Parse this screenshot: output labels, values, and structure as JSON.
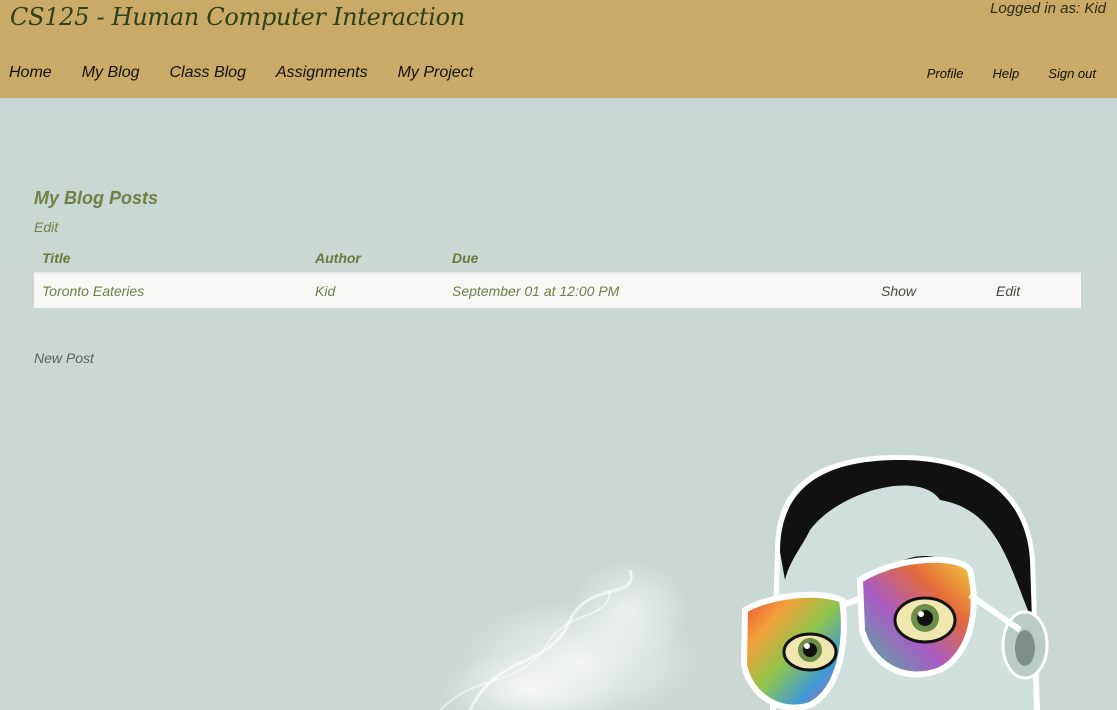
{
  "header": {
    "title": "CS125 - Human Computer Interaction",
    "logged_in": "Logged in as: Kid",
    "nav": [
      {
        "label": "Home"
      },
      {
        "label": "My Blog"
      },
      {
        "label": "Class Blog"
      },
      {
        "label": "Assignments"
      },
      {
        "label": "My Project"
      }
    ],
    "nav_right": [
      {
        "label": "Profile"
      },
      {
        "label": "Help"
      },
      {
        "label": "Sign out"
      }
    ]
  },
  "main": {
    "heading": "My Blog Posts",
    "edit_label": "Edit",
    "table": {
      "columns": [
        "Title",
        "Author",
        "Due"
      ],
      "rows": [
        {
          "title": "Toronto Eateries",
          "author": "Kid",
          "due": "September 01 at 12:00 PM",
          "show": "Show",
          "edit": "Edit"
        }
      ]
    },
    "new_post_label": "New Post"
  },
  "illustration": {
    "icon": "psychedelic-face-with-glasses-and-smoke"
  },
  "colors": {
    "header_bg": "#c9ab67",
    "accent_text": "#6f7f45",
    "page_bg": "#c7d7d2"
  }
}
